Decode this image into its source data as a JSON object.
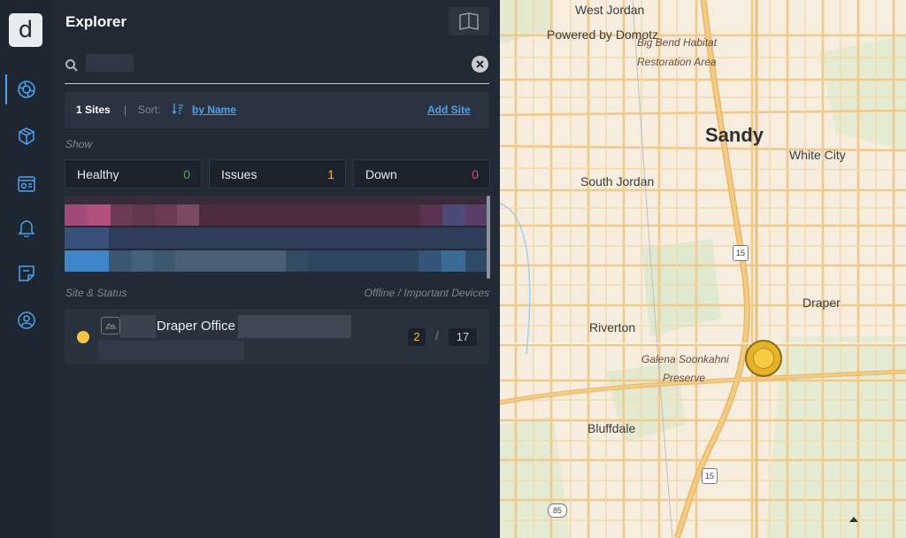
{
  "app": {
    "logo_letter": "d"
  },
  "nav": [
    {
      "name": "explorer-nav",
      "icon": "globe-icon",
      "active": true
    },
    {
      "name": "devices-nav",
      "icon": "cubes-icon",
      "active": false
    },
    {
      "name": "dashboard-nav",
      "icon": "dashboard-icon",
      "active": false
    },
    {
      "name": "alerts-nav",
      "icon": "bell-icon",
      "active": false
    },
    {
      "name": "tickets-nav",
      "icon": "ticket-icon",
      "active": false
    },
    {
      "name": "support-nav",
      "icon": "lifebuoy-icon",
      "active": false
    }
  ],
  "panel": {
    "title": "Explorer",
    "search": {
      "value": "",
      "placeholder": ""
    },
    "sites_count": "1 Sites",
    "separator": "|",
    "sort_label": "Sort:",
    "sort_value": "by Name",
    "add_site": "Add Site",
    "show_label": "Show",
    "filters": [
      {
        "label": "Healthy",
        "count": "0",
        "color": "#4caf50"
      },
      {
        "label": "Issues",
        "count": "1",
        "color": "#f5b335"
      },
      {
        "label": "Down",
        "count": "0",
        "color": "#e0457b"
      }
    ],
    "list_header_left": "Site & Status",
    "list_header_right": "Offline / Important Devices",
    "site": {
      "name": "Draper Office",
      "status_color": "#f5c542",
      "offline": "2",
      "divider": "/",
      "important": "17"
    }
  },
  "map": {
    "labels": {
      "west_jordan": "West Jordan",
      "powered_by": "Powered by Domotz",
      "big_bend_1": "Big Bend Habitat",
      "big_bend_2": "Restoration Area",
      "sandy": "Sandy",
      "white_city": "White City",
      "south_jordan": "South Jordan",
      "draper": "Draper",
      "riverton": "Riverton",
      "galena_1": "Galena Soonkahni",
      "galena_2": "Preserve",
      "bluffdale": "Bluffdale",
      "route_15_a": "15",
      "route_15_b": "15",
      "route_85": "85"
    },
    "marker_color": "#f5c542"
  }
}
